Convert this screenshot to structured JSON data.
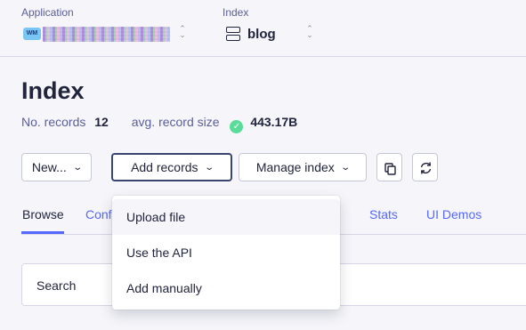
{
  "header": {
    "application_label": "Application",
    "app_badge": "WM",
    "index_label": "Index",
    "index_name": "blog"
  },
  "page": {
    "title": "Index",
    "records_label": "No. records",
    "records_value": "12",
    "size_label": "avg. record size",
    "size_value": "443.17B"
  },
  "toolbar": {
    "new_label": "New...",
    "add_records_label": "Add records",
    "manage_index_label": "Manage index"
  },
  "tabs": {
    "browse": "Browse",
    "configuration": "Conf",
    "stats": "Stats",
    "ui_demos": "UI Demos"
  },
  "search": {
    "label": "Search"
  },
  "dropdown": {
    "items": [
      "Upload file",
      "Use the API",
      "Add manually"
    ]
  },
  "colors": {
    "accent": "#5468ff",
    "text": "#21243d",
    "muted": "#5a5e9a",
    "ok": "#5adc98"
  }
}
